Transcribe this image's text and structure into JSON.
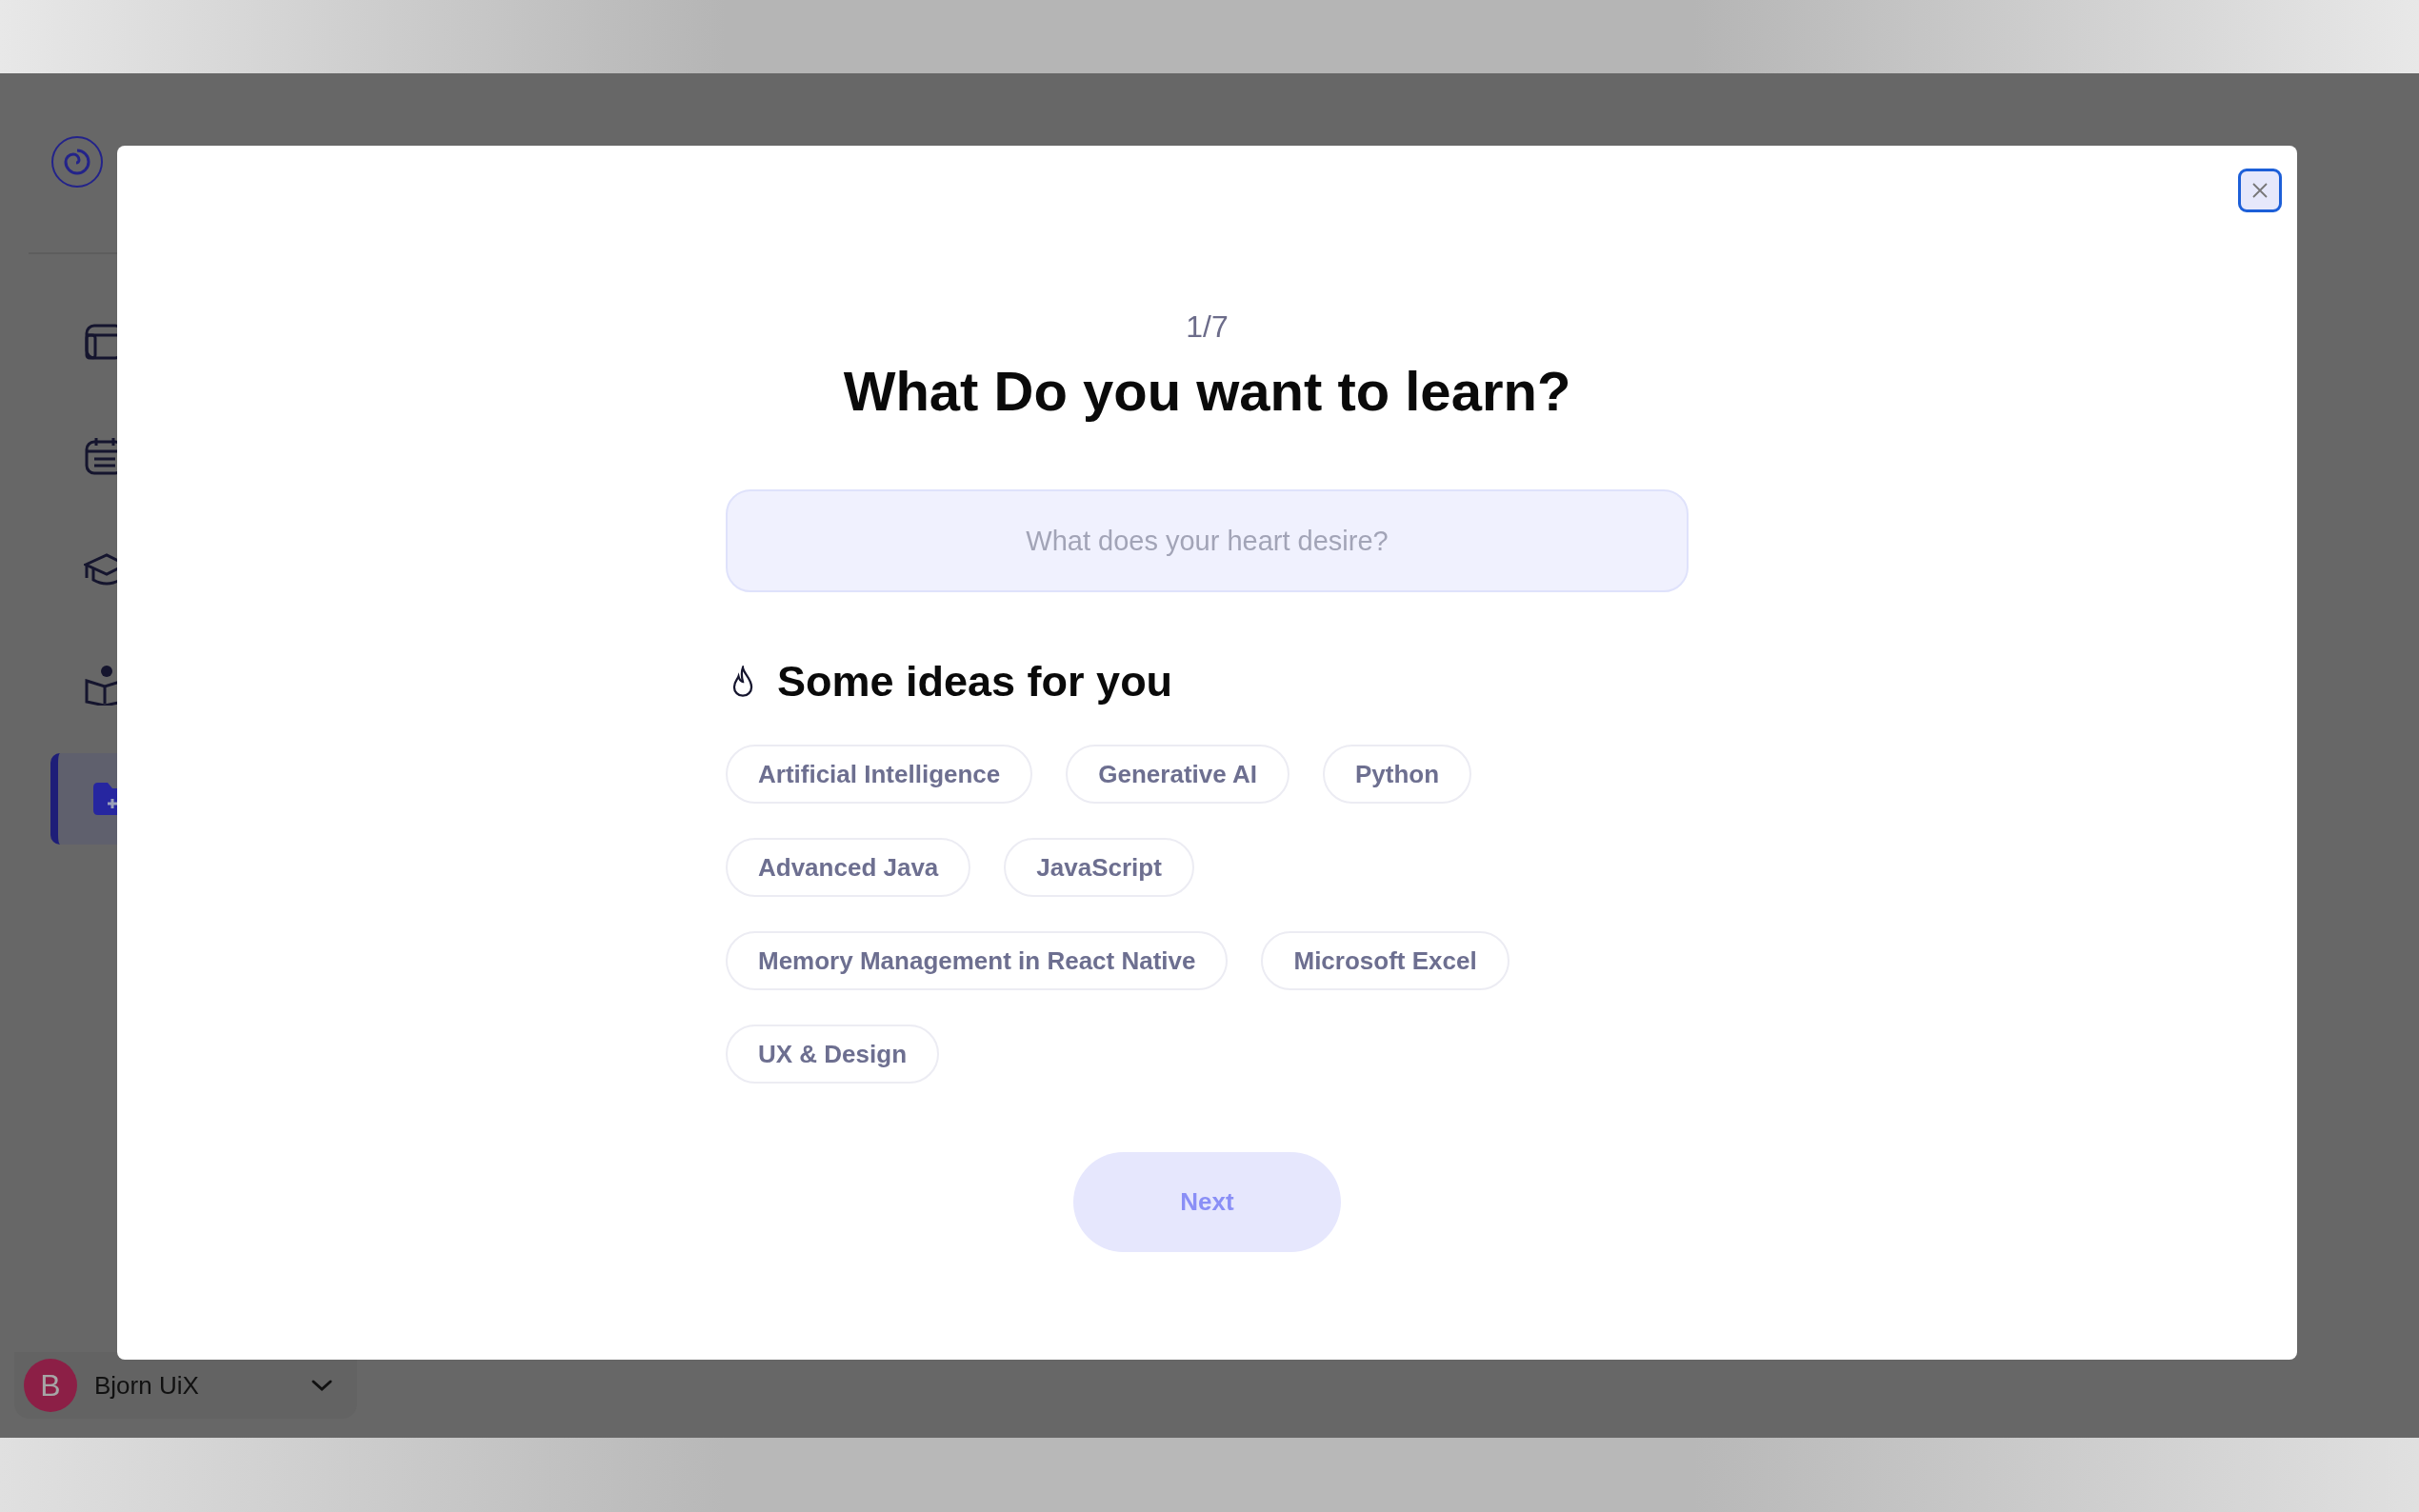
{
  "sidebar": {
    "nav_items": [
      {
        "kind": "browser",
        "selected": false
      },
      {
        "kind": "calendar",
        "selected": false
      },
      {
        "kind": "graduation",
        "selected": false
      },
      {
        "kind": "reader",
        "selected": false
      },
      {
        "kind": "folder",
        "selected": true
      }
    ]
  },
  "user": {
    "initial": "B",
    "name": "Bjorn UiX"
  },
  "modal": {
    "step": "1/7",
    "title": "What Do you want to learn?",
    "search": {
      "placeholder": "What does your heart desire?"
    },
    "ideas_heading": "Some ideas for you",
    "ideas": [
      "Artificial Intelligence",
      "Generative AI",
      "Python",
      "Advanced Java",
      "JavaScript",
      "Memory Management in React Native",
      "Microsoft Excel",
      "UX & Design"
    ],
    "next_button": {
      "label": "Next",
      "disabled": true
    }
  }
}
